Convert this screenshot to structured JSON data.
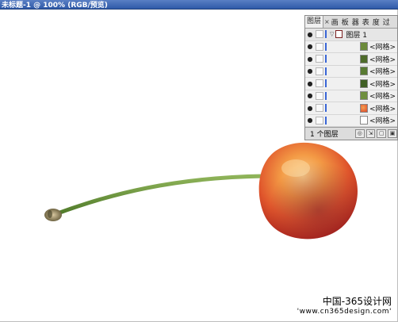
{
  "window": {
    "title": "未标题-1 @ 100% (RGB/预览)"
  },
  "layers_panel": {
    "tabs": [
      {
        "label": "图层",
        "active": true
      },
      {
        "label": "×"
      },
      {
        "label": "画"
      },
      {
        "label": "板"
      },
      {
        "label": "器"
      },
      {
        "label": "表"
      },
      {
        "label": "度"
      },
      {
        "label": "过"
      }
    ],
    "layer": {
      "name": "图层 1"
    },
    "sublayers": [
      {
        "label": "<网格>",
        "thumb_color": "#6b8a3a"
      },
      {
        "label": "<网格>",
        "thumb_color": "#4e6b2a"
      },
      {
        "label": "<网格>",
        "thumb_color": "#587a32"
      },
      {
        "label": "<网格>",
        "thumb_color": "#3f5f24"
      },
      {
        "label": "<网格>",
        "thumb_color": "#6f8f3f"
      },
      {
        "label": "<网格>",
        "thumb_color": "#d9462a"
      },
      {
        "label": "<网格>",
        "thumb_color": "#ffffff"
      }
    ],
    "footer": {
      "count_label": "1 个图层"
    }
  },
  "watermark": {
    "line1": "中国-365设计网",
    "line2": "'www.cn365design.com'"
  },
  "colors": {
    "titlebar": "#2f5aa8",
    "layer_color_bar": "#3a66d6",
    "cherry_red": "#d9462a",
    "cherry_orange": "#f29a3f",
    "stem_green": "#6f9a3a"
  }
}
